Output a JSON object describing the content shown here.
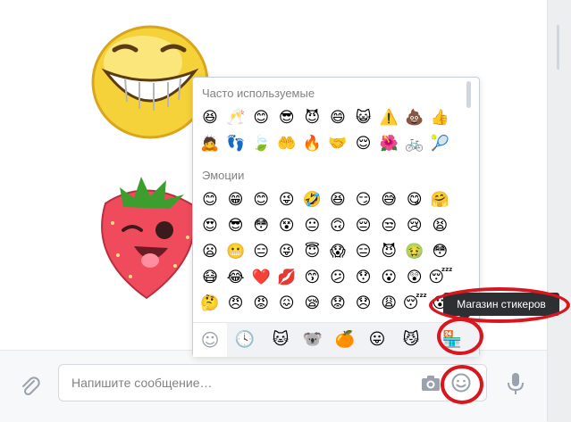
{
  "chat": {
    "stickers": [
      {
        "name": "laughing-smiley-sticker"
      },
      {
        "name": "winking-strawberry-sticker"
      }
    ]
  },
  "composer": {
    "placeholder": "Напишите сообщение…",
    "attach_icon": "paperclip-icon",
    "camera_icon": "camera-icon",
    "emoji_icon": "smiley-icon",
    "mic_icon": "microphone-icon"
  },
  "emoji_picker": {
    "sections": [
      {
        "title": "Часто используемые",
        "rows": [
          [
            "😆",
            "🥂",
            "😊",
            "😎",
            "😈",
            "😄",
            "😺",
            "⚠️",
            "💩",
            "👍"
          ],
          [
            "🙇",
            "👣",
            "🍃",
            "🤲",
            "🔥",
            "🤝",
            "😌",
            "🌺",
            "🚲",
            "🎾"
          ]
        ]
      },
      {
        "title": "Эмоции",
        "rows": [
          [
            "😊",
            "😁",
            "😊",
            "😜",
            "🤣",
            "😆",
            "😏",
            "😅",
            "😋",
            "🤗"
          ],
          [
            "😍",
            "😎",
            "😳",
            "😵",
            "😐",
            "🙃",
            "😔",
            "😒",
            "😢",
            "😫"
          ],
          [
            "😦",
            "😬",
            "😑",
            "😜",
            "😇",
            "😱",
            "😑",
            "😈",
            "🤢",
            "😳"
          ],
          [
            "😷",
            "😂",
            "❤️",
            "💋",
            "😙",
            "😕",
            "😯",
            "😮",
            "😲",
            "😴"
          ],
          [
            "🤔",
            "😠",
            "😡",
            "😖",
            "😪",
            "😟",
            "😞",
            "😩",
            "😴",
            "😮"
          ]
        ]
      }
    ],
    "tabs": [
      {
        "icon": "smiley-tab-icon",
        "glyph": "☺"
      },
      {
        "icon": "recent-clock-icon",
        "glyph": "🕓"
      },
      {
        "icon": "cat-sticker-pack-icon",
        "glyph": "🐱"
      },
      {
        "icon": "koala-sticker-pack-icon",
        "glyph": "🐨"
      },
      {
        "icon": "orange-sticker-pack-icon",
        "glyph": "🍊"
      },
      {
        "icon": "tongue-face-pack-icon",
        "glyph": "😛"
      },
      {
        "icon": "bat-cat-pack-icon",
        "glyph": "😼"
      },
      {
        "icon": "sticker-store-icon",
        "glyph": "🏪"
      }
    ]
  },
  "tooltip": {
    "text": "Магазин стикеров"
  },
  "colors": {
    "annotation_red": "#d9161f",
    "tooltip_bg": "#2d3033"
  }
}
